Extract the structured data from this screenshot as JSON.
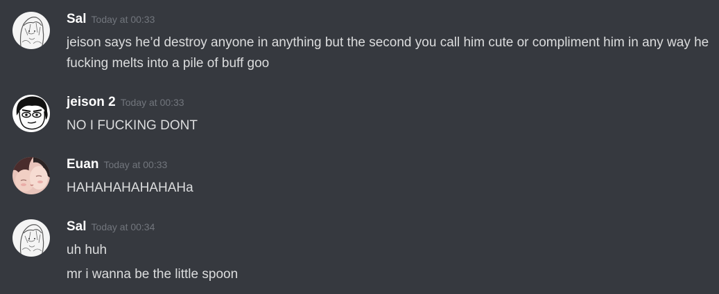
{
  "messages": [
    {
      "username": "Sal",
      "timestamp": "Today at 00:33",
      "avatar_icon": "sketch-portrait-avatar",
      "lines": [
        "jeison says he’d destroy anyone in anything but the second you call him cute or compliment him in any way he fucking melts into a pile of buff goo"
      ]
    },
    {
      "username": "jeison 2",
      "timestamp": "Today at 00:33",
      "avatar_icon": "cartoon-face-avatar",
      "lines": [
        "NO I FUCKING DONT"
      ]
    },
    {
      "username": "Euan",
      "timestamp": "Today at 00:33",
      "avatar_icon": "illustrated-couple-avatar",
      "lines": [
        "HAHAHAHAHAHAHa"
      ]
    },
    {
      "username": "Sal",
      "timestamp": "Today at 00:34",
      "avatar_icon": "sketch-portrait-avatar",
      "lines": [
        "uh huh",
        "mr i wanna be the little spoon"
      ]
    }
  ],
  "colors": {
    "background": "#36393f",
    "username": "#ffffff",
    "timestamp": "#72767d",
    "message_text": "#dcddde"
  }
}
